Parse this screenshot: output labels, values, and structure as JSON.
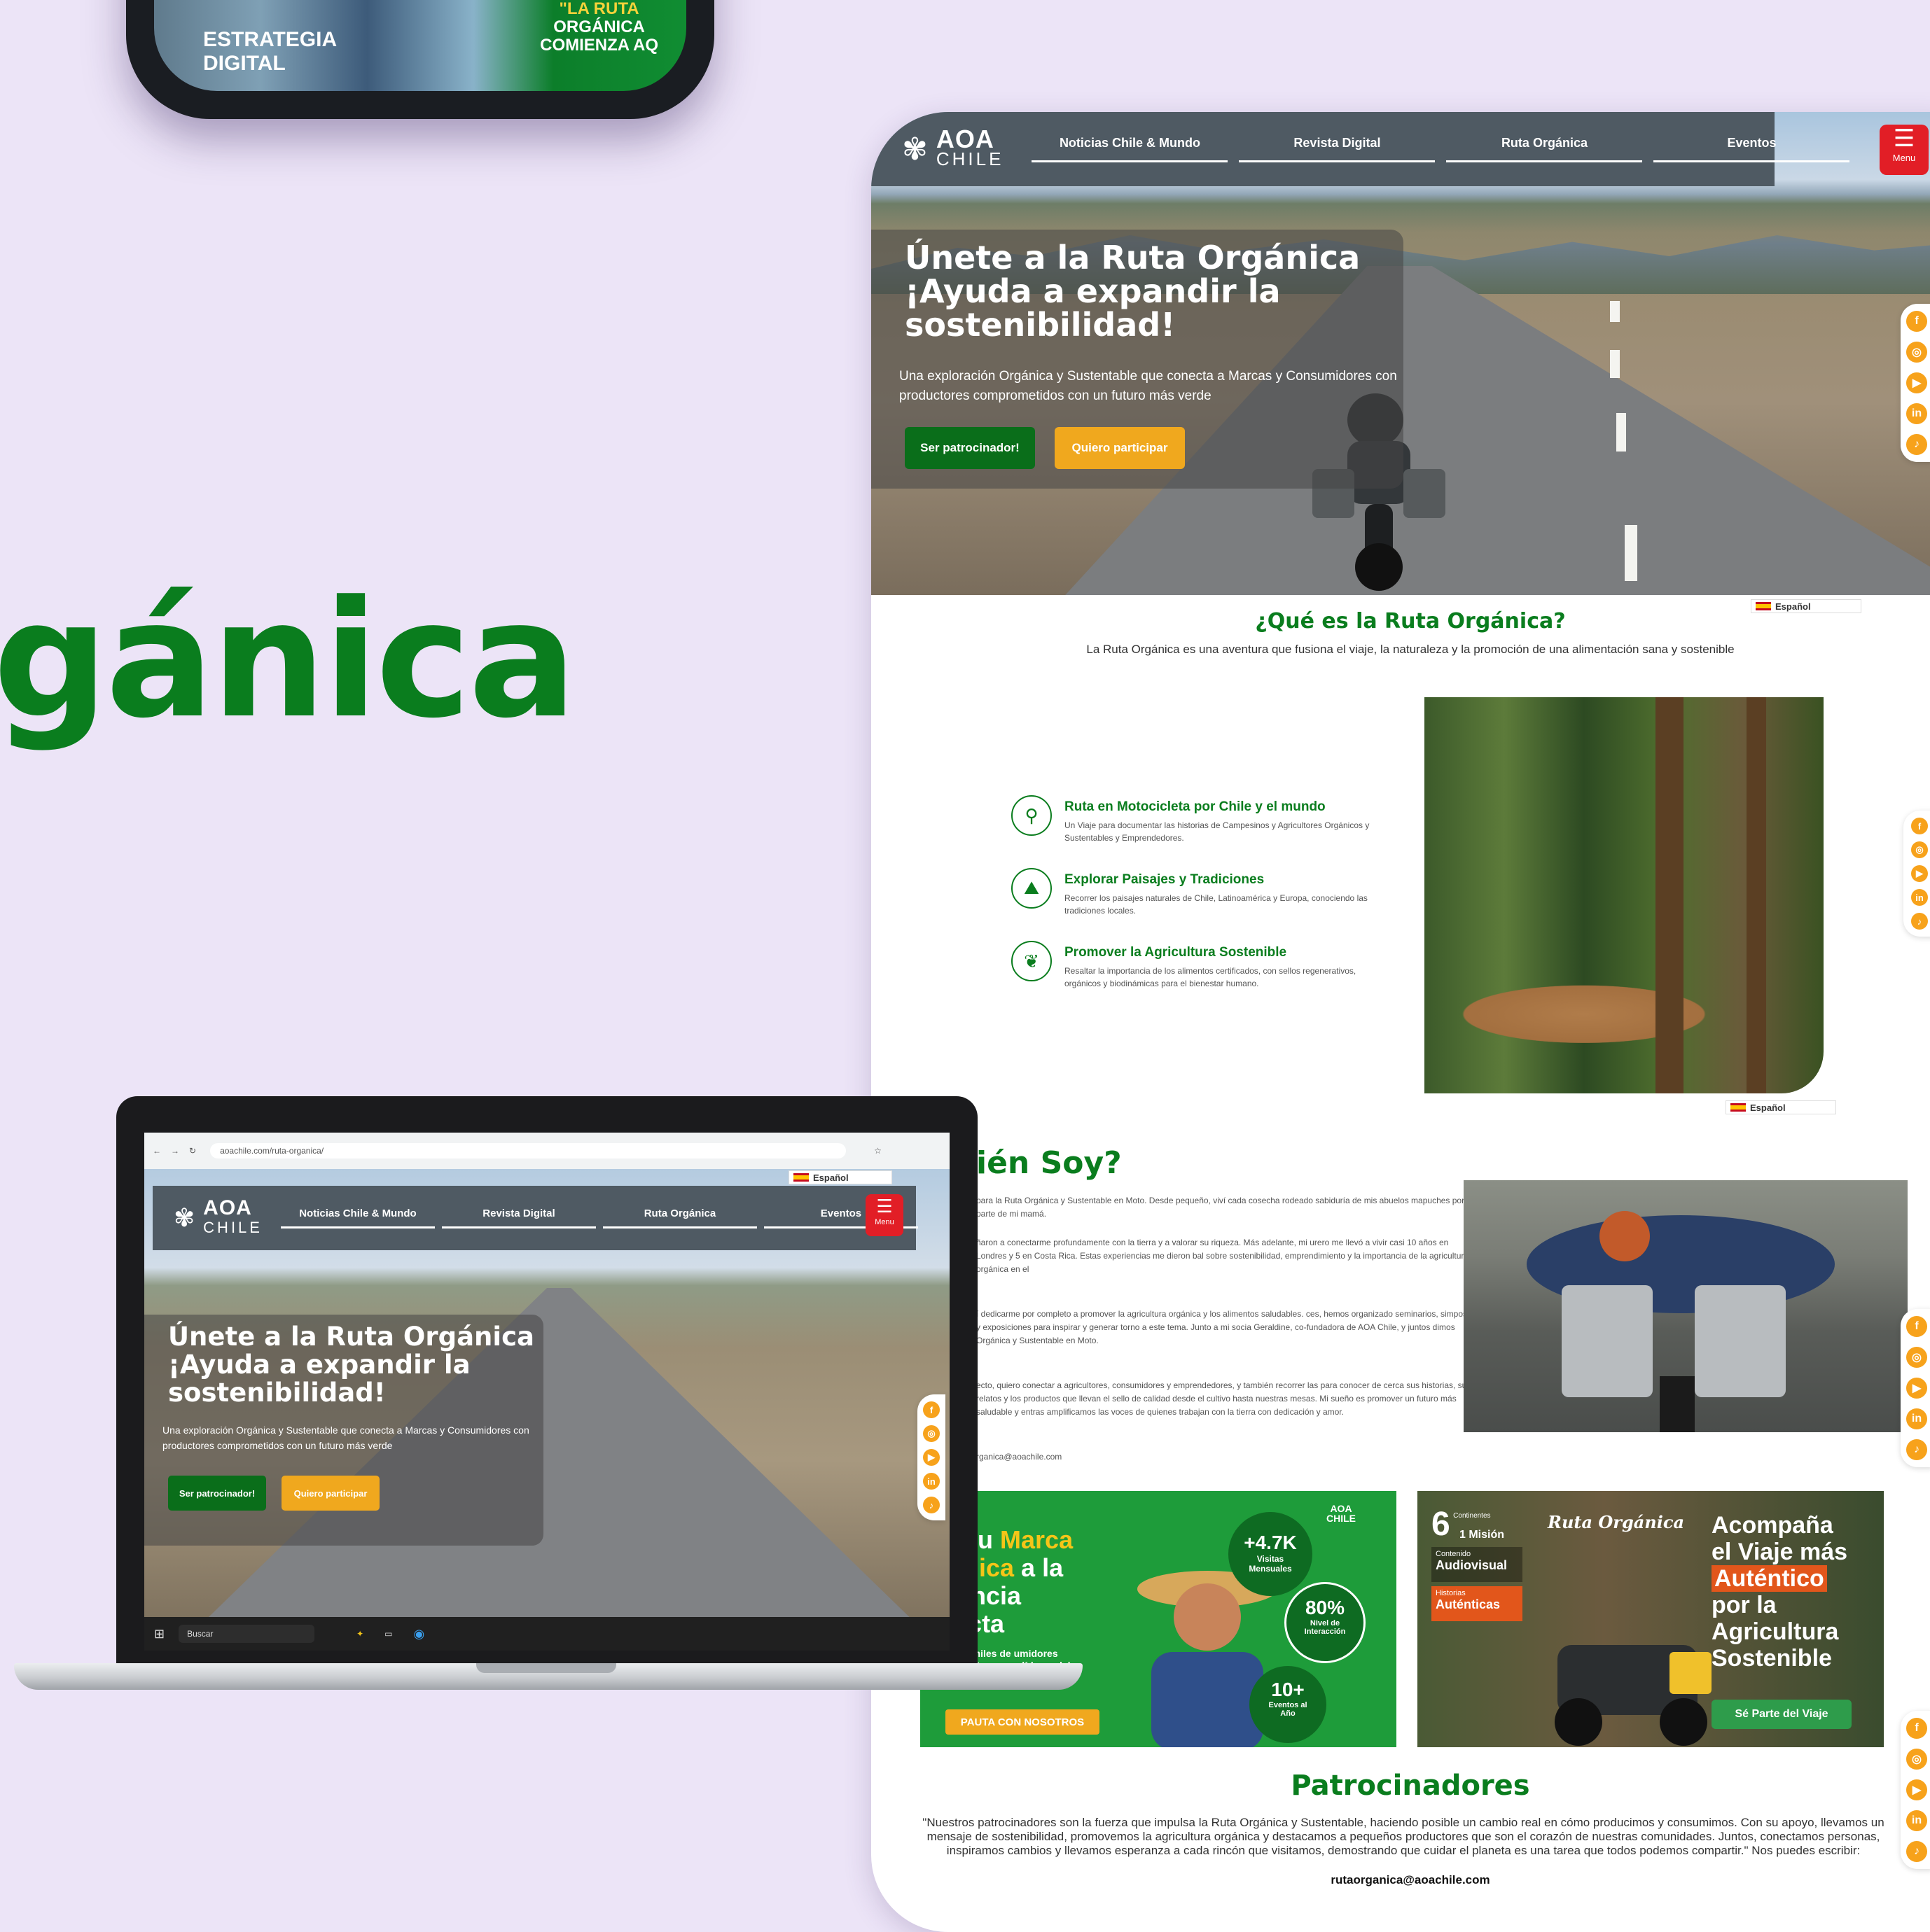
{
  "showcase_title": "gánica",
  "phone": {
    "left_text": "ESTRATEGIA\nDIGITAL",
    "right_line1": "\"LA RUTA",
    "right_line2": "ORGÁNICA",
    "right_line3": "COMIENZA AQ"
  },
  "site": {
    "logo": {
      "line1": "AOA",
      "line2": "CHILE"
    },
    "nav": [
      "Noticias Chile & Mundo",
      "Revista Digital",
      "Ruta Orgánica",
      "Eventos"
    ],
    "menu_label": "Menu",
    "hero": {
      "title": "Únete a la Ruta Orgánica ¡Ayuda a expandir la sostenibilidad!",
      "subtitle": "Una exploración Orgánica y Sustentable que conecta a Marcas y Consumidores con productores comprometidos con un futuro más verde",
      "btn_sponsor": "Ser patrocinador!",
      "btn_join": "Quiero participar"
    },
    "language": "Español",
    "social_icons": [
      "facebook-icon",
      "instagram-icon",
      "youtube-icon",
      "linkedin-icon",
      "tiktok-icon"
    ],
    "what": {
      "title": "¿Qué es la Ruta Orgánica?",
      "subtitle": "La Ruta Orgánica es una aventura que fusiona el viaje, la naturaleza y la promoción de una alimentación sana y sostenible"
    },
    "features": [
      {
        "title": "Ruta en Motocicleta por Chile y el mundo",
        "desc": "Un Viaje para documentar las historias de Campesinos y Agricultores Orgánicos y Sustentables y Emprendedores."
      },
      {
        "title": "Explorar Paisajes y Tradiciones",
        "desc": "Recorrer los paisajes naturales de Chile, Latinoamérica y Europa, conociendo las tradiciones locales."
      },
      {
        "title": "Promover la Agricultura Sostenible",
        "desc": "Resaltar la importancia de los alimentos certificados, con sellos regenerativos, orgánicos y biodinámicas para el bienestar humano."
      }
    ],
    "who": {
      "title": "ién Soy?",
      "p1": "para la Ruta Orgánica y Sustentable en Moto. Desde pequeño, viví cada cosecha rodeado sabiduría de mis abuelos mapuches por parte de mi mamá.",
      "p2": "ñaron a conectarme profundamente con la tierra y a valorar su riqueza. Más adelante, mi urero me llevó a vivir casi 10 años en Londres y 5 en Costa Rica. Estas experiencias me dieron bal sobre sostenibilidad, emprendimiento y la importancia de la agricultura orgánica en el",
      "p3": "í dedicarme por completo a promover la agricultura orgánica y los alimentos saludables. ces, hemos organizado seminarios, simposios y exposiciones para inspirar y generar torno a este tema. Junto a mi socia Geraldine, co-fundadora de AOA Chile, y juntos dimos Orgánica y Sustentable en Moto.",
      "p4": "ecto, quiero conectar a agricultores, consumidores y emprendedores, y también recorrer las para conocer de cerca sus historias, sus relatos y los productos que llevan el sello de calidad desde el cultivo hasta nuestras mesas. Mi sueño es promover un futuro más saludable y entras amplificamos las voces de quienes trabajan con la tierra con dedicación y amor.",
      "email": "rganica@aoachile.com"
    },
    "banner1": {
      "headline_a": "va tu ",
      "headline_b": "Marca",
      "headline_c": "gánica",
      "headline_d": " a la",
      "headline_e": "diencia",
      "headline_f": "rrecta",
      "small": "cto con miles de umidores conscientes resas líderes del",
      "cta": "PAUTA CON NOSOTROS",
      "stat1_value": "+4.7K",
      "stat1_label": "Visitas Mensuales",
      "stat2_value": "80%",
      "stat2_label": "Nivel de Interacción",
      "stat3_value": "10+",
      "stat3_label": "Eventos al Año",
      "logo_a": "AOA",
      "logo_b": "CHILE"
    },
    "banner2": {
      "badge1_num": "6",
      "badge1_small": "Continentes",
      "badge1_label": "1 Misión",
      "badge2_small": "Contenido",
      "badge2_label": "Audiovisual",
      "badge3_small": "Historias",
      "badge3_label": "Auténticas",
      "logo": "Ruta Orgánica",
      "headline1": "Acompaña",
      "headline2": "el Viaje más",
      "headline3": "Auténtico",
      "headline4": "por la",
      "headline5": "Agricultura",
      "headline6": "Sostenible",
      "cta": "Sé Parte del Viaje"
    },
    "sponsors": {
      "title": "Patrocinadores",
      "text": "\"Nuestros patrocinadores son la fuerza que impulsa la Ruta Orgánica y Sustentable, haciendo posible un cambio real en cómo producimos y consumimos. Con su apoyo, llevamos un mensaje de sostenibilidad, promovemos la agricultura orgánica y destacamos a pequeños productores que son el corazón de nuestras comunidades. Juntos, conectamos personas, inspiramos cambios y llevamos esperanza a cada rincón que visitamos, demostrando que cuidar el planeta es una tarea que todos podemos compartir.\" Nos puedes escribir:",
      "email": "rutaorganica@aoachile.com"
    }
  },
  "laptop": {
    "url": "aoachile.com/ruta-organica/",
    "language": "Español",
    "nav": [
      "Noticias Chile & Mundo",
      "Revista Digital",
      "Ruta Orgánica",
      "Eventos"
    ],
    "menu_label": "Menu",
    "hero_title": "Únete a la Ruta Orgánica ¡Ayuda a expandir la sostenibilidad!",
    "hero_sub": "Una exploración Orgánica y Sustentable que conecta a Marcas y Consumidores con productores comprometidos con un futuro más verde",
    "btn_sponsor": "Ser patrocinador!",
    "btn_join": "Quiero participar",
    "taskbar_search": "Buscar"
  },
  "colors": {
    "background": "#ece4f7",
    "brand_green": "#0a7d1e",
    "accent_yellow": "#f0a81e",
    "menu_red": "#e21e26",
    "nav_gray": "#4f5a63"
  }
}
